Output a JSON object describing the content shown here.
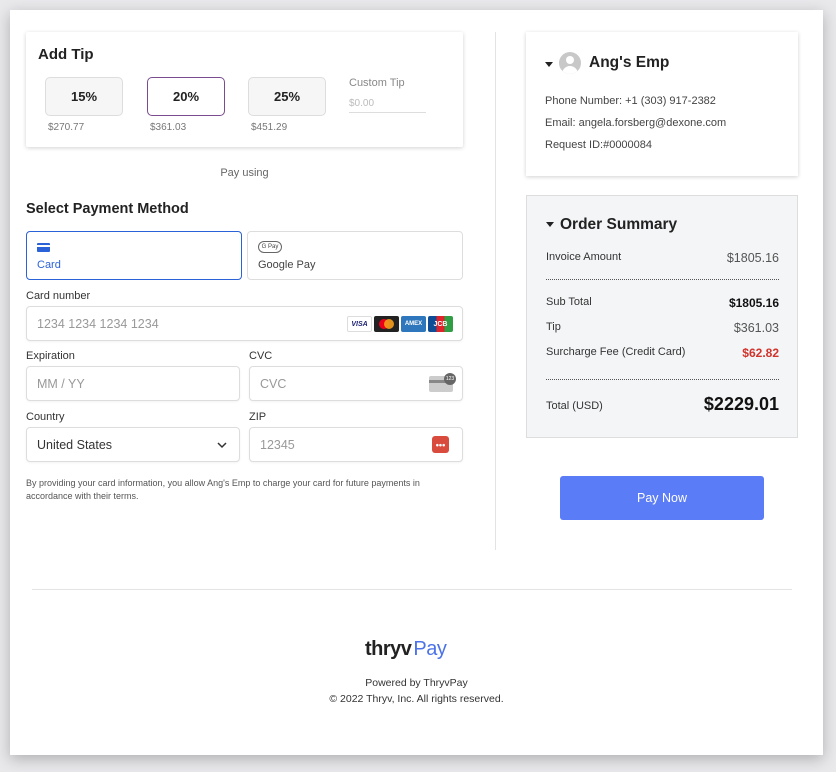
{
  "tip": {
    "title": "Add Tip",
    "options": [
      {
        "label": "15%",
        "amount": "$270.77",
        "selected": false
      },
      {
        "label": "20%",
        "amount": "$361.03",
        "selected": true
      },
      {
        "label": "25%",
        "amount": "$451.29",
        "selected": false
      }
    ],
    "custom_label": "Custom Tip",
    "custom_placeholder": "$0.00"
  },
  "pay_using": "Pay using",
  "payment": {
    "title": "Select Payment Method",
    "methods": [
      {
        "label": "Card",
        "icon": "card-icon",
        "active": true
      },
      {
        "label": "Google Pay",
        "icon": "gpay-icon",
        "icon_text": "G Pay",
        "active": false
      }
    ]
  },
  "form": {
    "card_number_label": "Card number",
    "card_number_placeholder": "1234 1234 1234 1234",
    "brands": [
      "VISA",
      "MC",
      "AMEX",
      "JCB"
    ],
    "expiration_label": "Expiration",
    "expiration_placeholder": "MM / YY",
    "cvc_label": "CVC",
    "cvc_placeholder": "CVC",
    "country_label": "Country",
    "country_value": "United States",
    "zip_label": "ZIP",
    "zip_placeholder": "12345",
    "zip_icon_text": "•••",
    "terms": "By providing your card information, you allow Ang's Emp to charge your card for future payments in accordance with their terms."
  },
  "merchant": {
    "name": "Ang's Emp",
    "phone": "Phone Number: +1 (303) 917-2382",
    "email": "Email: angela.forsberg@dexone.com",
    "request_id": "Request ID:#0000084"
  },
  "summary": {
    "title": "Order Summary",
    "invoice_label": "Invoice Amount",
    "invoice_value": "$1805.16",
    "subtotal_label": "Sub Total",
    "subtotal_value": "$1805.16",
    "tip_label": "Tip",
    "tip_value": "$361.03",
    "surcharge_label": "Surcharge Fee (Credit Card)",
    "surcharge_value": "$62.82",
    "total_label": "Total (USD)",
    "total_value": "$2229.01"
  },
  "pay_now_label": "Pay Now",
  "footer": {
    "logo_main": "thryv",
    "logo_pay": "Pay",
    "powered": "Powered by ThryvPay",
    "copyright": "© 2022 Thryv, Inc. All rights reserved."
  },
  "colors": {
    "accent_blue": "#2b62d8",
    "pay_button": "#5b7cf7",
    "tip_selected_border": "#7a4b8f",
    "surcharge_red": "#d0342c"
  }
}
